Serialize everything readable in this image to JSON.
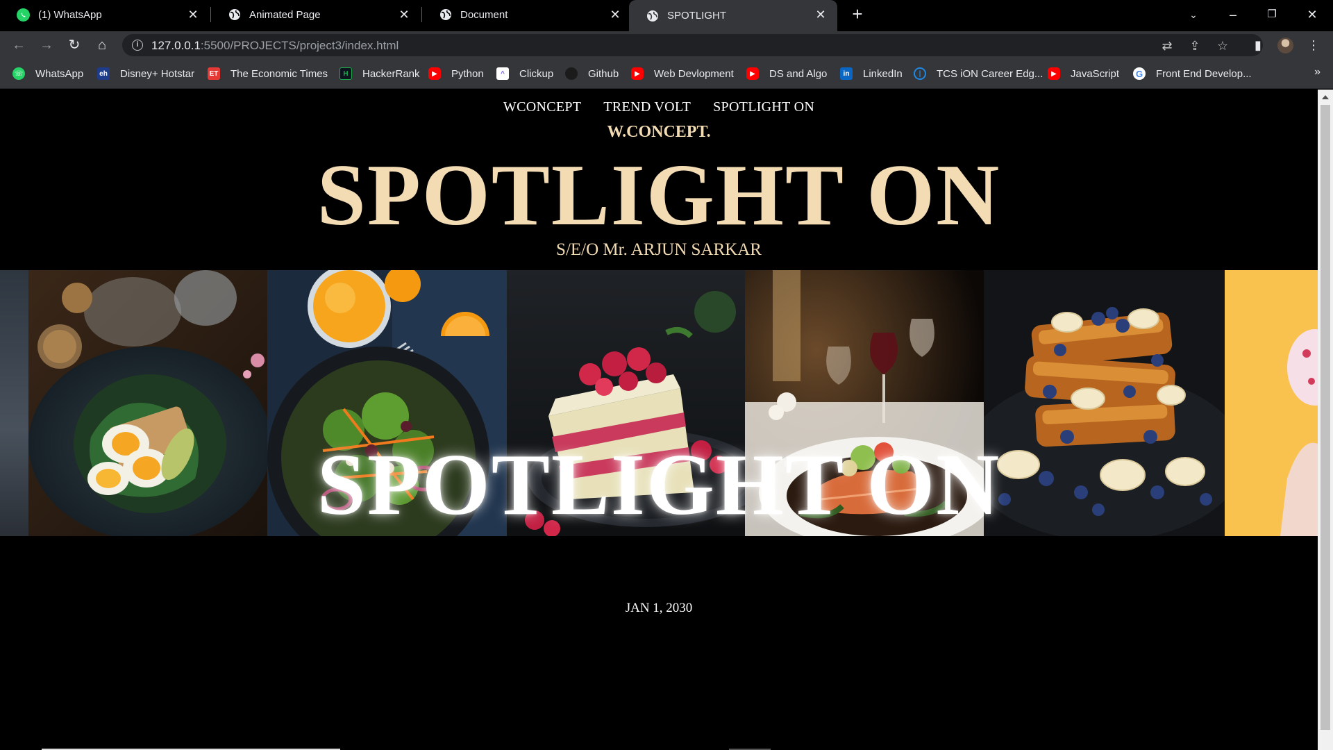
{
  "browser": {
    "tabs": [
      {
        "label": "(1) WhatsApp",
        "icon": "whatsapp-icon",
        "active": false
      },
      {
        "label": "Animated Page",
        "icon": "globe-icon",
        "active": false
      },
      {
        "label": "Document",
        "icon": "globe-icon",
        "active": false
      },
      {
        "label": "SPOTLIGHT",
        "icon": "globe-icon",
        "active": true
      }
    ],
    "url_host": "127.0.0.1",
    "url_rest": ":5500/PROJECTS/project3/index.html",
    "bookmarks": [
      {
        "label": "WhatsApp",
        "icon": "whatsapp-icon",
        "color": "#25d366"
      },
      {
        "label": "Disney+ Hotstar",
        "icon": "hotstar-icon",
        "color": "#1f3c8a"
      },
      {
        "label": "The Economic Times",
        "icon": "et-icon",
        "color": "#e53935"
      },
      {
        "label": "HackerRank",
        "icon": "hackerrank-icon",
        "color": "#1ba94c"
      },
      {
        "label": "Python",
        "icon": "youtube-icon",
        "color": "#ff0000"
      },
      {
        "label": "Clickup",
        "icon": "clickup-icon",
        "color": "#7b68ee"
      },
      {
        "label": "Github",
        "icon": "github-icon",
        "color": "#000000"
      },
      {
        "label": "Web Devlopment",
        "icon": "youtube-icon",
        "color": "#ff0000"
      },
      {
        "label": "DS and Algo",
        "icon": "youtube-icon",
        "color": "#ff0000"
      },
      {
        "label": "LinkedIn",
        "icon": "linkedin-icon",
        "color": "#0a66c2"
      },
      {
        "label": "TCS iON Career Edg...",
        "icon": "tcs-icon",
        "color": "#1e88e5"
      },
      {
        "label": "JavaScript",
        "icon": "youtube-icon",
        "color": "#ff0000"
      },
      {
        "label": "Front End Develop...",
        "icon": "google-icon",
        "color": "#ffffff"
      }
    ]
  },
  "page": {
    "nav": [
      "WCONCEPT",
      "TREND VOLT",
      "SPOTLIGHT ON"
    ],
    "brand": "W.CONCEPT.",
    "hero_title": "SPOTLIGHT ON",
    "byline": "S/E/O Mr. ARJUN SARKAR",
    "date": "JAN 1, 2030",
    "accent_color": "#f3dcb4"
  }
}
